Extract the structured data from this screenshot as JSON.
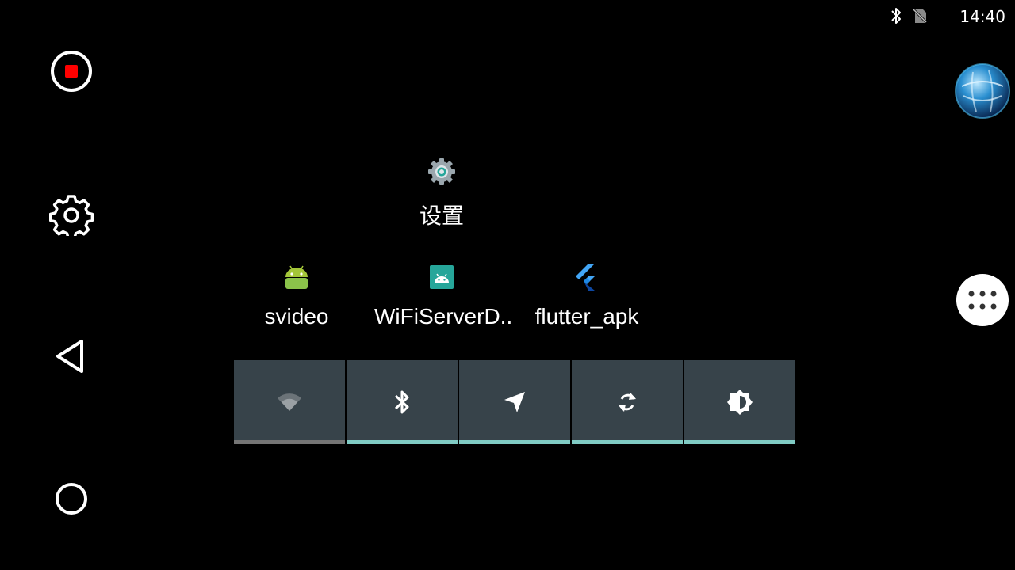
{
  "status_bar": {
    "time": "14:40",
    "icons": [
      "bluetooth-icon",
      "no-sim-icon"
    ]
  },
  "left_nav": {
    "items": [
      {
        "name": "record",
        "icon": "record-stop-icon",
        "accent": "#ff0000"
      },
      {
        "name": "settings",
        "icon": "gear-icon"
      },
      {
        "name": "back",
        "icon": "back-triangle-icon"
      },
      {
        "name": "home",
        "icon": "home-circle-icon"
      }
    ]
  },
  "apps": [
    {
      "label": "设置",
      "icon": "settings-gear-icon"
    },
    {
      "label": "svideo",
      "icon": "android-icon",
      "color": "#a4c639"
    },
    {
      "label": "WiFiServerD..",
      "icon": "android-app-icon",
      "color": "#26a69a"
    },
    {
      "label": "flutter_apk",
      "icon": "flutter-icon",
      "color": "#42a5f5"
    }
  ],
  "quick_settings": {
    "tiles": [
      {
        "name": "wifi",
        "icon": "wifi-icon",
        "active": false
      },
      {
        "name": "bluetooth",
        "icon": "bluetooth-icon",
        "active": true
      },
      {
        "name": "location",
        "icon": "location-arrow-icon",
        "active": true
      },
      {
        "name": "sync",
        "icon": "sync-icon",
        "active": true
      },
      {
        "name": "brightness",
        "icon": "brightness-icon",
        "active": true
      }
    ],
    "colors": {
      "tile_bg": "#37434a",
      "active_bar": "#80cbc4",
      "inactive_bar": "#757575"
    }
  },
  "floating": {
    "globe_icon": "globe-icon",
    "apps_icon": "app-drawer-icon"
  }
}
